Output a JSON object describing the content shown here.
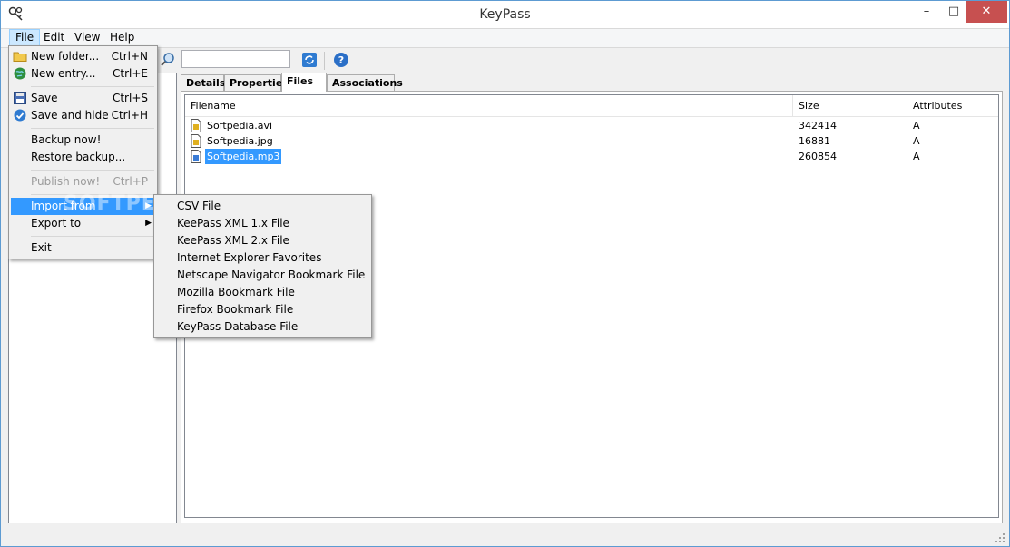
{
  "window": {
    "title": "KeyPass"
  },
  "menubar": {
    "file": "File",
    "edit": "Edit",
    "view": "View",
    "help": "Help"
  },
  "file_menu": {
    "new_folder": {
      "label": "New folder...",
      "shortcut": "Ctrl+N"
    },
    "new_entry": {
      "label": "New entry...",
      "shortcut": "Ctrl+E"
    },
    "save": {
      "label": "Save",
      "shortcut": "Ctrl+S"
    },
    "save_hide": {
      "label": "Save and hide",
      "shortcut": "Ctrl+H"
    },
    "backup": {
      "label": "Backup now!"
    },
    "restore": {
      "label": "Restore backup..."
    },
    "publish": {
      "label": "Publish now!",
      "shortcut": "Ctrl+P"
    },
    "import_from": {
      "label": "Import from"
    },
    "export_to": {
      "label": "Export to"
    },
    "exit": {
      "label": "Exit"
    }
  },
  "import_submenu": [
    "CSV File",
    "KeePass XML 1.x File",
    "KeePass XML 2.x File",
    "Internet Explorer Favorites",
    "Netscape Navigator Bookmark File",
    "Mozilla Bookmark File",
    "Firefox Bookmark File",
    "KeyPass Database File"
  ],
  "tabs": {
    "details": "Details",
    "properties": "Properties",
    "files": "Files",
    "associations": "Associations"
  },
  "files_table": {
    "columns": {
      "filename": "Filename",
      "size": "Size",
      "attributes": "Attributes"
    },
    "rows": [
      {
        "filename": "Softpedia.avi",
        "size": "342414",
        "attributes": "A"
      },
      {
        "filename": "Softpedia.jpg",
        "size": "16881",
        "attributes": "A"
      },
      {
        "filename": "Softpedia.mp3",
        "size": "260854",
        "attributes": "A",
        "selected": true
      }
    ]
  },
  "watermark": "SOFTPEDIA",
  "colors": {
    "selection": "#3399ff",
    "close_button": "#c75050"
  }
}
